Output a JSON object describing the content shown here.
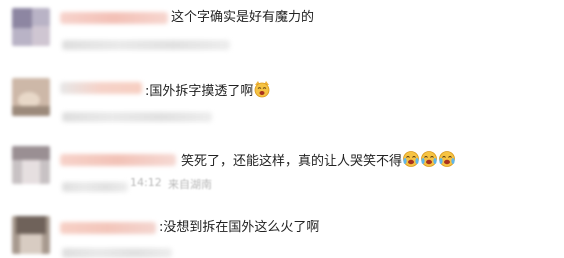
{
  "comments": [
    {
      "text": "这个字确实是好有魔力的",
      "emojis": 0
    },
    {
      "text": ":国外拆字摸透了啊",
      "emojis": 1
    },
    {
      "text": "笑死了，还能这样，真的让人哭笑不得",
      "emojis": 3
    },
    {
      "text": ":没想到拆在国外这么火了啊",
      "emojis": 0
    }
  ],
  "meta": {
    "blurred_time_3": "14:12",
    "blurred_location_3": "来自湖南"
  },
  "icons": {
    "cat_emoji": "cat-laugh-emoji",
    "crying_laugh_emoji": "crying-laugh-emoji"
  },
  "colors": {
    "text": "#222222",
    "meta": "#b8b8b8",
    "name_blur": "#f5c9bf"
  }
}
